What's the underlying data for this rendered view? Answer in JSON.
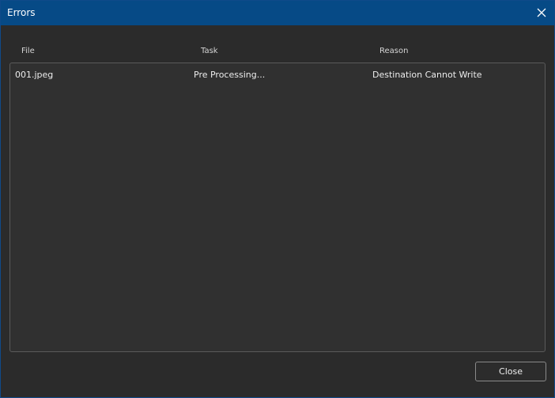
{
  "window": {
    "title": "Errors"
  },
  "columns": {
    "file": "File",
    "task": "Task",
    "reason": "Reason"
  },
  "rows": [
    {
      "file": "001.jpeg",
      "task": "Pre Processing...",
      "reason": "Destination Cannot Write"
    }
  ],
  "footer": {
    "close_label": "Close"
  },
  "icons": {
    "close": "close-icon"
  },
  "colors": {
    "titlebar": "#064a86",
    "background": "#2b2b2b",
    "panel": "#303030"
  }
}
